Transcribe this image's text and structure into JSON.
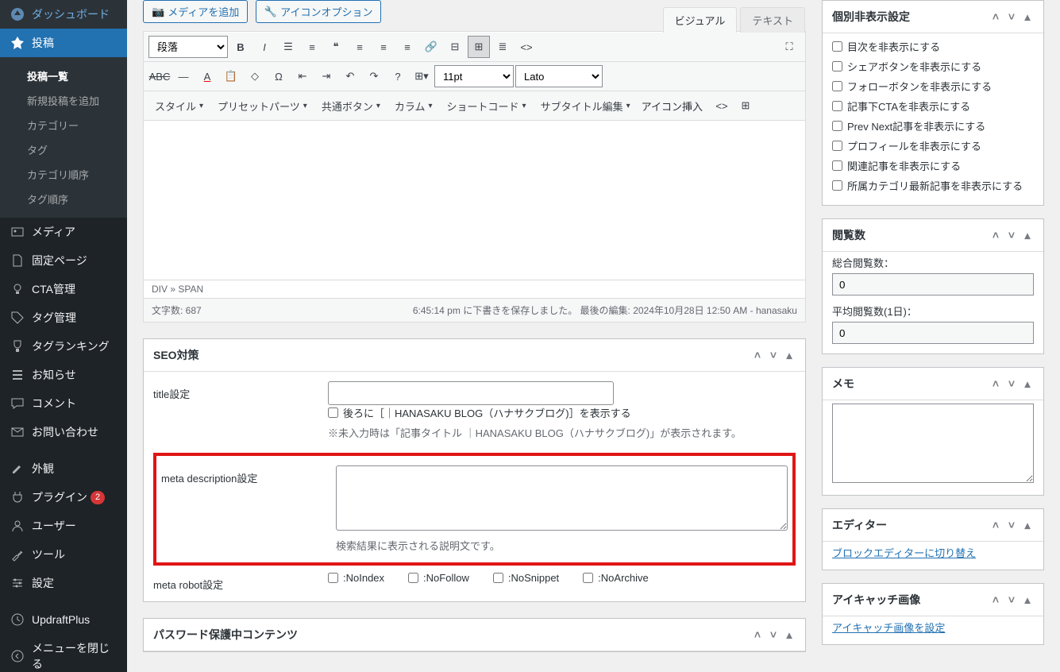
{
  "sidebar": {
    "dashboard": "ダッシュボード",
    "posts": "投稿",
    "posts_sub": [
      "投稿一覧",
      "新規投稿を追加",
      "カテゴリー",
      "タグ",
      "カテゴリ順序",
      "タグ順序"
    ],
    "media": "メディア",
    "pages": "固定ページ",
    "cta": "CTA管理",
    "tag_mgmt": "タグ管理",
    "tag_rank": "タグランキング",
    "notice": "お知らせ",
    "comments": "コメント",
    "contact": "お問い合わせ",
    "appearance": "外観",
    "plugins": "プラグイン",
    "plugins_badge": "2",
    "users": "ユーザー",
    "tools": "ツール",
    "settings": "設定",
    "updraft": "UpdraftPlus",
    "collapse": "メニューを閉じる"
  },
  "editor": {
    "add_media": "メディアを追加",
    "icon_option": "アイコンオプション",
    "tab_visual": "ビジュアル",
    "tab_text": "テキスト",
    "format_select": "段落",
    "font_size": "11pt",
    "font_family": "Lato",
    "row3": [
      "スタイル",
      "プリセットパーツ",
      "共通ボタン",
      "カラム",
      "ショートコード",
      "サブタイトル編集",
      "アイコン挿入"
    ],
    "path": "DIV » SPAN",
    "char_count": "文字数: 687",
    "save_status": "6:45:14 pm に下書きを保存しました。 最後の編集: 2024年10月28日 12:50 AM - hanasaku"
  },
  "seo": {
    "title": "SEO対策",
    "title_label": "title設定",
    "title_suffix": "後ろに［｜HANASAKU BLOG（ハナサクブログ)］を表示する",
    "title_help": "※未入力時は「記事タイトル ｜HANASAKU BLOG（ハナサクブログ)」が表示されます。",
    "desc_label": "meta description設定",
    "desc_help": "検索結果に表示される説明文です。",
    "robot_label": "meta robot設定",
    "robot_opts": [
      ":NoIndex",
      ":NoFollow",
      ":NoSnippet",
      ":NoArchive"
    ]
  },
  "password_panel": "パスワード保護中コンテンツ",
  "right": {
    "hide_panel": "個別非表示設定",
    "hide_opts": [
      "目次を非表示にする",
      "シェアボタンを非表示にする",
      "フォローボタンを非表示にする",
      "記事下CTAを非表示にする",
      "Prev Next記事を非表示にする",
      "プロフィールを非表示にする",
      "関連記事を非表示にする",
      "所属カテゴリ最新記事を非表示にする"
    ],
    "views_panel": "閲覧数",
    "views_total_label": "総合閲覧数：",
    "views_total": "0",
    "views_avg_label": "平均閲覧数(1日)：",
    "views_avg": "0",
    "memo_panel": "メモ",
    "editor_panel": "エディター",
    "editor_switch": "ブロックエディターに切り替え",
    "thumb_panel": "アイキャッチ画像",
    "thumb_set": "アイキャッチ画像を設定"
  }
}
